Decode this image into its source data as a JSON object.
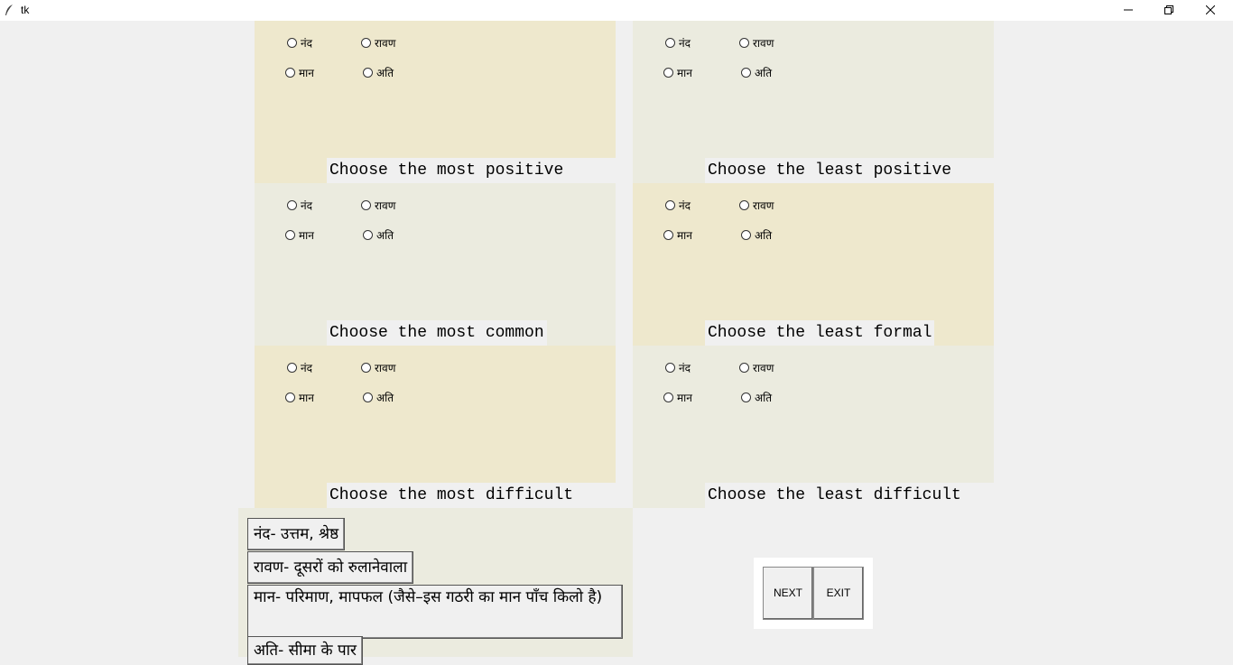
{
  "window": {
    "title": "tk",
    "minimize_icon": "minimize-icon",
    "maximize_icon": "restore-icon",
    "close_icon": "close-icon"
  },
  "colors": {
    "panel_yellow": "#eee8cd",
    "panel_gray": "#ebebdf",
    "background": "#f0f0f0"
  },
  "options": {
    "o1": "नंद",
    "o2": "रावण",
    "o3": "मान",
    "o4": "अति"
  },
  "panels": [
    {
      "prompt": "Choose the most positive"
    },
    {
      "prompt": "Choose the least positive"
    },
    {
      "prompt": "Choose the most common"
    },
    {
      "prompt": "Choose the least formal"
    },
    {
      "prompt": "Choose the most difficult"
    },
    {
      "prompt": "Choose the least difficult"
    }
  ],
  "glossary": [
    "नंद- उत्तम, श्रेष्ठ",
    "रावण- दूसरों को रुलानेवाला",
    "मान- परिमाण, मापफल (जैसे–इस गठरी का मान पाँच किलो है)",
    "अति- सीमा के पार"
  ],
  "buttons": {
    "next": "NEXT",
    "exit": "EXIT"
  }
}
